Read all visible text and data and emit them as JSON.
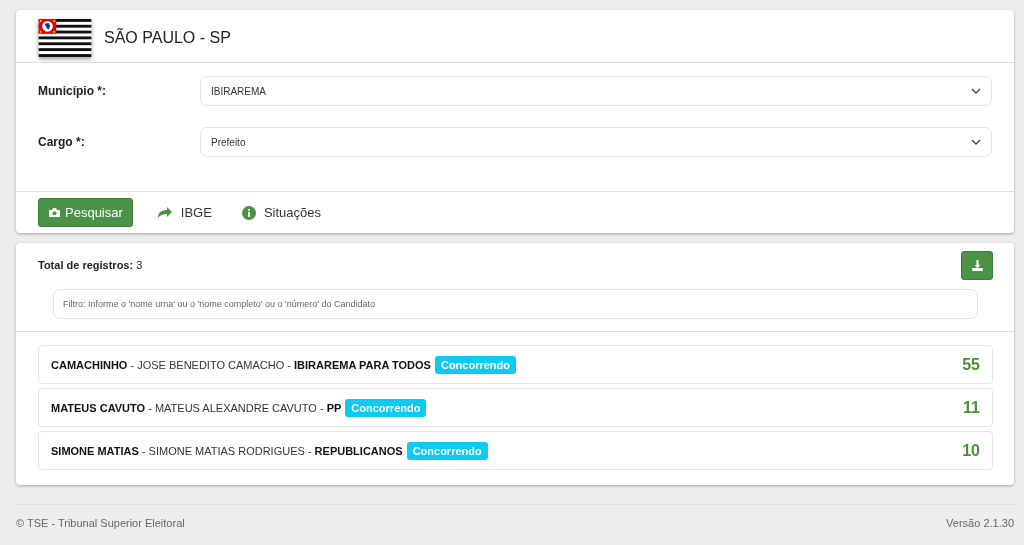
{
  "header": {
    "title": "SÃO PAULO - SP"
  },
  "fields": [
    {
      "label": "Município *:",
      "value": "IBIRAREMA"
    },
    {
      "label": "Cargo *:",
      "value": "Prefeito"
    }
  ],
  "actions": [
    {
      "kind": "primary",
      "label": "Pesquisar"
    },
    {
      "kind": "link-share",
      "label": "IBGE"
    },
    {
      "kind": "link-info",
      "label": "Situações"
    }
  ],
  "results": {
    "total_label": "Total de registros:",
    "total": "3",
    "filter": {
      "placeholder": "Filtro: Informe o 'nome urna' ou o 'nome completo' ou o 'número' do Candidato"
    },
    "candidates": [
      {
        "text": "**CAMACHINHO** - JOSE BENEDITO CAMACHO - **IBIRAREMA PARA TODOS**",
        "status": "Concorrendo",
        "number": "55"
      },
      {
        "text": "**MATEUS CAVUTO** - MATEUS ALEXANDRE CAVUTO - **PP**",
        "status": "Concorrendo",
        "number": "11"
      },
      {
        "text": "**SIMONE MATIAS** - SIMONE MATIAS RODRIGUES - **REPUBLICANOS**",
        "status": "Concorrendo",
        "number": "10"
      }
    ]
  },
  "footer": {
    "copyright": "© TSE - Tribunal Superior Eleitoral",
    "version": "Versão 2.1.30"
  }
}
